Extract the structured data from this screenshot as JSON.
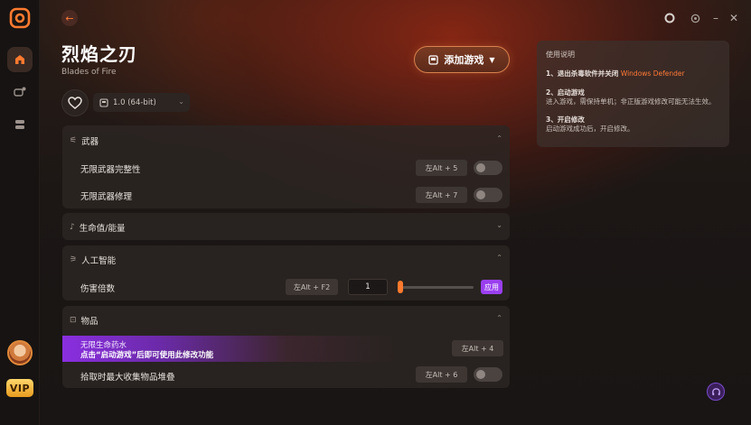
{
  "app": {
    "window_controls": [
      "O",
      "◎",
      "–",
      "✕"
    ]
  },
  "sidebar": {
    "items": [
      {
        "name": "home",
        "active": true
      },
      {
        "name": "games",
        "active": false
      },
      {
        "name": "library",
        "active": false
      }
    ],
    "vip_label": "VIP"
  },
  "game": {
    "title": "烈焰之刃",
    "subtitle": "Blades of Fire",
    "add_button_label": "添加游戏",
    "version": "1.0 (64-bit)"
  },
  "sections": {
    "weapons": {
      "title": "武器",
      "rows": [
        {
          "label": "无限武器完整性",
          "hotkey": "左Alt + 5",
          "enabled": false
        },
        {
          "label": "无限武器修理",
          "hotkey": "左Alt + 7",
          "enabled": false
        }
      ]
    },
    "health": {
      "title": "生命值/能量"
    },
    "ai": {
      "title": "人工智能",
      "row": {
        "label": "伤害倍数",
        "hotkey": "左Alt + F2",
        "value": "1",
        "apply_label": "应用",
        "slider_fraction": 0.0
      }
    },
    "items": {
      "title": "物品",
      "promo": {
        "label": "无限生命药水",
        "notice": "点击“启动游戏”后即可使用此修改功能",
        "hotkey": "左Alt + 4"
      },
      "row": {
        "label": "拾取时最大收集物品堆叠",
        "hotkey": "左Alt + 6",
        "enabled": false
      }
    }
  },
  "instructions": {
    "title": "使用说明",
    "step1_title": "1、退出杀毒软件并关闭",
    "step1_highlight": "Windows Defender",
    "step2_title": "2、启动游戏",
    "step2_body": "进入游戏，需保持单机；非正版游戏修改可能无法生效。",
    "step3_title": "3、开启修改",
    "step3_body": "启动游戏成功后，开启修改。"
  },
  "colors": {
    "accent": "#ff7a38",
    "apply": "#9a3ff0",
    "vip": "#f2b53a"
  }
}
